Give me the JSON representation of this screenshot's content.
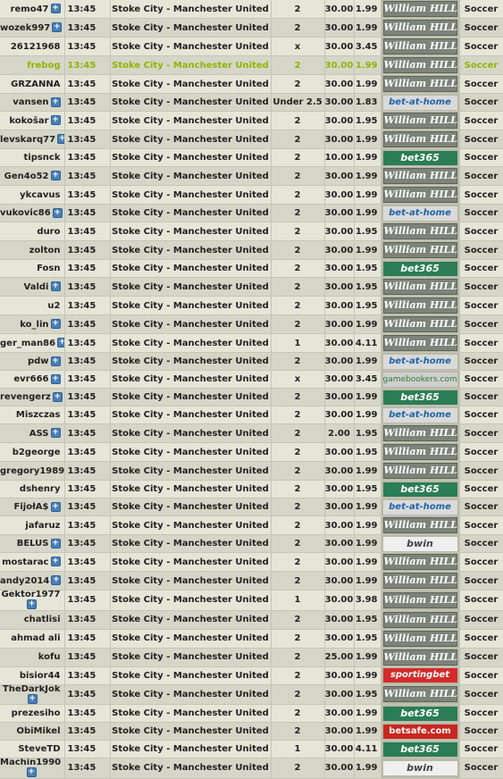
{
  "rows": [
    {
      "user": "remo47",
      "plus": true,
      "time": "13:45",
      "match": "Stoke City - Manchester United",
      "tip": "2",
      "stake": "30.00",
      "odds": "1.99",
      "bookmaker": "William HILL",
      "bookie_key": "wh",
      "sport": "Soccer"
    },
    {
      "user": "wozek997",
      "plus": true,
      "time": "13:45",
      "match": "Stoke City - Manchester United",
      "tip": "2",
      "stake": "30.00",
      "odds": "1.99",
      "bookmaker": "William HILL",
      "bookie_key": "wh",
      "sport": "Soccer"
    },
    {
      "user": "26121968",
      "plus": false,
      "time": "13:45",
      "match": "Stoke City - Manchester United",
      "tip": "x",
      "stake": "30.00",
      "odds": "3.45",
      "bookmaker": "William HILL",
      "bookie_key": "wh",
      "sport": "Soccer"
    },
    {
      "user": "frebog",
      "plus": false,
      "time": "13:45",
      "match": "Stoke City - Manchester United",
      "tip": "2",
      "stake": "30.00",
      "odds": "1.99",
      "bookmaker": "William HILL",
      "bookie_key": "wh",
      "sport": "Soccer",
      "highlight": true
    },
    {
      "user": "GRZANNA",
      "plus": false,
      "time": "13:45",
      "match": "Stoke City - Manchester United",
      "tip": "2",
      "stake": "30.00",
      "odds": "1.99",
      "bookmaker": "William HILL",
      "bookie_key": "wh",
      "sport": "Soccer"
    },
    {
      "user": "vansen",
      "plus": true,
      "time": "13:45",
      "match": "Stoke City - Manchester United",
      "tip": "Under 2.5",
      "stake": "30.00",
      "odds": "1.83",
      "bookmaker": "bet-at-home",
      "bookie_key": "bah",
      "sport": "Soccer"
    },
    {
      "user": "kokošar",
      "plus": true,
      "time": "13:45",
      "match": "Stoke City - Manchester United",
      "tip": "2",
      "stake": "30.00",
      "odds": "1.95",
      "bookmaker": "William HILL",
      "bookie_key": "wh",
      "sport": "Soccer"
    },
    {
      "user": "levskarq77",
      "plus": true,
      "time": "13:45",
      "match": "Stoke City - Manchester United",
      "tip": "2",
      "stake": "30.00",
      "odds": "1.99",
      "bookmaker": "William HILL",
      "bookie_key": "wh",
      "sport": "Soccer"
    },
    {
      "user": "tipsnck",
      "plus": false,
      "time": "13:45",
      "match": "Stoke City - Manchester United",
      "tip": "2",
      "stake": "10.00",
      "odds": "1.99",
      "bookmaker": "bet365",
      "bookie_key": "b365",
      "sport": "Soccer"
    },
    {
      "user": "Gen4o52",
      "plus": true,
      "time": "13:45",
      "match": "Stoke City - Manchester United",
      "tip": "2",
      "stake": "30.00",
      "odds": "1.99",
      "bookmaker": "William HILL",
      "bookie_key": "wh",
      "sport": "Soccer"
    },
    {
      "user": "ykcavus",
      "plus": false,
      "time": "13:45",
      "match": "Stoke City - Manchester United",
      "tip": "2",
      "stake": "30.00",
      "odds": "1.99",
      "bookmaker": "William HILL",
      "bookie_key": "wh",
      "sport": "Soccer"
    },
    {
      "user": "vukovic86",
      "plus": true,
      "time": "13:45",
      "match": "Stoke City - Manchester United",
      "tip": "2",
      "stake": "30.00",
      "odds": "1.99",
      "bookmaker": "bet-at-home",
      "bookie_key": "bah",
      "sport": "Soccer"
    },
    {
      "user": "duro",
      "plus": false,
      "time": "13:45",
      "match": "Stoke City - Manchester United",
      "tip": "2",
      "stake": "30.00",
      "odds": "1.95",
      "bookmaker": "William HILL",
      "bookie_key": "wh",
      "sport": "Soccer"
    },
    {
      "user": "zolton",
      "plus": false,
      "time": "13:45",
      "match": "Stoke City - Manchester United",
      "tip": "2",
      "stake": "30.00",
      "odds": "1.99",
      "bookmaker": "William HILL",
      "bookie_key": "wh",
      "sport": "Soccer"
    },
    {
      "user": "Fosn",
      "plus": false,
      "time": "13:45",
      "match": "Stoke City - Manchester United",
      "tip": "2",
      "stake": "30.00",
      "odds": "1.95",
      "bookmaker": "bet365",
      "bookie_key": "b365",
      "sport": "Soccer"
    },
    {
      "user": "Valdi",
      "plus": true,
      "time": "13:45",
      "match": "Stoke City - Manchester United",
      "tip": "2",
      "stake": "30.00",
      "odds": "1.95",
      "bookmaker": "William HILL",
      "bookie_key": "wh",
      "sport": "Soccer"
    },
    {
      "user": "u2",
      "plus": false,
      "time": "13:45",
      "match": "Stoke City - Manchester United",
      "tip": "2",
      "stake": "30.00",
      "odds": "1.95",
      "bookmaker": "William HILL",
      "bookie_key": "wh",
      "sport": "Soccer"
    },
    {
      "user": "ko_lin",
      "plus": true,
      "time": "13:45",
      "match": "Stoke City - Manchester United",
      "tip": "2",
      "stake": "30.00",
      "odds": "1.99",
      "bookmaker": "William HILL",
      "bookie_key": "wh",
      "sport": "Soccer"
    },
    {
      "user": "ger_man86",
      "plus": true,
      "time": "13:45",
      "match": "Stoke City - Manchester United",
      "tip": "1",
      "stake": "30.00",
      "odds": "4.11",
      "bookmaker": "William HILL",
      "bookie_key": "wh",
      "sport": "Soccer"
    },
    {
      "user": "pdw",
      "plus": true,
      "time": "13:45",
      "match": "Stoke City - Manchester United",
      "tip": "2",
      "stake": "30.00",
      "odds": "1.99",
      "bookmaker": "bet-at-home",
      "bookie_key": "bah",
      "sport": "Soccer"
    },
    {
      "user": "evr666",
      "plus": true,
      "time": "13:45",
      "match": "Stoke City - Manchester United",
      "tip": "x",
      "stake": "30.00",
      "odds": "3.45",
      "bookmaker": "gamebookers.com",
      "bookie_key": "gb",
      "sport": "Soccer"
    },
    {
      "user": "revengerz",
      "plus": true,
      "time": "13:45",
      "match": "Stoke City - Manchester United",
      "tip": "2",
      "stake": "30.00",
      "odds": "1.99",
      "bookmaker": "bet365",
      "bookie_key": "b365",
      "sport": "Soccer"
    },
    {
      "user": "Miszczas",
      "plus": false,
      "time": "13:45",
      "match": "Stoke City - Manchester United",
      "tip": "2",
      "stake": "30.00",
      "odds": "1.99",
      "bookmaker": "bet-at-home",
      "bookie_key": "bah",
      "sport": "Soccer"
    },
    {
      "user": "ASS",
      "plus": true,
      "time": "13:45",
      "match": "Stoke City - Manchester United",
      "tip": "2",
      "stake": "2.00",
      "odds": "1.95",
      "bookmaker": "William HILL",
      "bookie_key": "wh",
      "sport": "Soccer"
    },
    {
      "user": "b2george",
      "plus": false,
      "time": "13:45",
      "match": "Stoke City - Manchester United",
      "tip": "2",
      "stake": "30.00",
      "odds": "1.95",
      "bookmaker": "William HILL",
      "bookie_key": "wh",
      "sport": "Soccer"
    },
    {
      "user": "gregory1989",
      "plus": false,
      "time": "13:45",
      "match": "Stoke City - Manchester United",
      "tip": "2",
      "stake": "30.00",
      "odds": "1.99",
      "bookmaker": "William HILL",
      "bookie_key": "wh",
      "sport": "Soccer"
    },
    {
      "user": "dshenry",
      "plus": false,
      "time": "13:45",
      "match": "Stoke City - Manchester United",
      "tip": "2",
      "stake": "30.00",
      "odds": "1.95",
      "bookmaker": "bet365",
      "bookie_key": "b365",
      "sport": "Soccer"
    },
    {
      "user": "FijołA$",
      "plus": true,
      "time": "13:45",
      "match": "Stoke City - Manchester United",
      "tip": "2",
      "stake": "30.00",
      "odds": "1.99",
      "bookmaker": "bet-at-home",
      "bookie_key": "bah",
      "sport": "Soccer"
    },
    {
      "user": "jafaruz",
      "plus": false,
      "time": "13:45",
      "match": "Stoke City - Manchester United",
      "tip": "2",
      "stake": "30.00",
      "odds": "1.99",
      "bookmaker": "William HILL",
      "bookie_key": "wh",
      "sport": "Soccer"
    },
    {
      "user": "BELUS",
      "plus": true,
      "time": "13:45",
      "match": "Stoke City - Manchester United",
      "tip": "2",
      "stake": "30.00",
      "odds": "1.99",
      "bookmaker": "bwin",
      "bookie_key": "bwin",
      "sport": "Soccer"
    },
    {
      "user": "mostarac",
      "plus": true,
      "time": "13:45",
      "match": "Stoke City - Manchester United",
      "tip": "2",
      "stake": "30.00",
      "odds": "1.99",
      "bookmaker": "William HILL",
      "bookie_key": "wh",
      "sport": "Soccer"
    },
    {
      "user": "andy2014",
      "plus": true,
      "time": "13:45",
      "match": "Stoke City - Manchester United",
      "tip": "2",
      "stake": "30.00",
      "odds": "1.99",
      "bookmaker": "William HILL",
      "bookie_key": "wh",
      "sport": "Soccer"
    },
    {
      "user": "Gektor1977",
      "plus": true,
      "wrap": true,
      "time": "13:45",
      "match": "Stoke City - Manchester United",
      "tip": "1",
      "stake": "30.00",
      "odds": "3.98",
      "bookmaker": "William HILL",
      "bookie_key": "wh",
      "sport": "Soccer"
    },
    {
      "user": "chatlisi",
      "plus": false,
      "time": "13:45",
      "match": "Stoke City - Manchester United",
      "tip": "2",
      "stake": "30.00",
      "odds": "1.95",
      "bookmaker": "William HILL",
      "bookie_key": "wh",
      "sport": "Soccer"
    },
    {
      "user": "ahmad ali",
      "plus": false,
      "time": "13:45",
      "match": "Stoke City - Manchester United",
      "tip": "2",
      "stake": "30.00",
      "odds": "1.95",
      "bookmaker": "William HILL",
      "bookie_key": "wh",
      "sport": "Soccer"
    },
    {
      "user": "kofu",
      "plus": false,
      "time": "13:45",
      "match": "Stoke City - Manchester United",
      "tip": "2",
      "stake": "25.00",
      "odds": "1.99",
      "bookmaker": "William HILL",
      "bookie_key": "wh",
      "sport": "Soccer"
    },
    {
      "user": "bisior44",
      "plus": false,
      "time": "13:45",
      "match": "Stoke City - Manchester United",
      "tip": "2",
      "stake": "30.00",
      "odds": "1.99",
      "bookmaker": "sportingbet",
      "bookie_key": "sb",
      "sport": "Soccer"
    },
    {
      "user": "TheDarkJok",
      "plus": true,
      "wrap": true,
      "time": "13:45",
      "match": "Stoke City - Manchester United",
      "tip": "2",
      "stake": "30.00",
      "odds": "1.95",
      "bookmaker": "William HILL",
      "bookie_key": "wh",
      "sport": "Soccer"
    },
    {
      "user": "prezesiho",
      "plus": false,
      "time": "13:45",
      "match": "Stoke City - Manchester United",
      "tip": "2",
      "stake": "30.00",
      "odds": "1.99",
      "bookmaker": "bet365",
      "bookie_key": "b365",
      "sport": "Soccer"
    },
    {
      "user": "ObiMikel",
      "plus": false,
      "time": "13:45",
      "match": "Stoke City - Manchester United",
      "tip": "2",
      "stake": "30.00",
      "odds": "1.99",
      "bookmaker": "betsafe.com",
      "bookie_key": "bsafe",
      "sport": "Soccer"
    },
    {
      "user": "SteveTD",
      "plus": false,
      "time": "13:45",
      "match": "Stoke City - Manchester United",
      "tip": "1",
      "stake": "30.00",
      "odds": "4.11",
      "bookmaker": "bet365",
      "bookie_key": "b365",
      "sport": "Soccer"
    },
    {
      "user": "Machin1990",
      "plus": true,
      "wrap": true,
      "time": "13:45",
      "match": "Stoke City - Manchester United",
      "tip": "2",
      "stake": "30.00",
      "odds": "1.99",
      "bookmaker": "bwin",
      "bookie_key": "bwin",
      "sport": "Soccer"
    }
  ]
}
